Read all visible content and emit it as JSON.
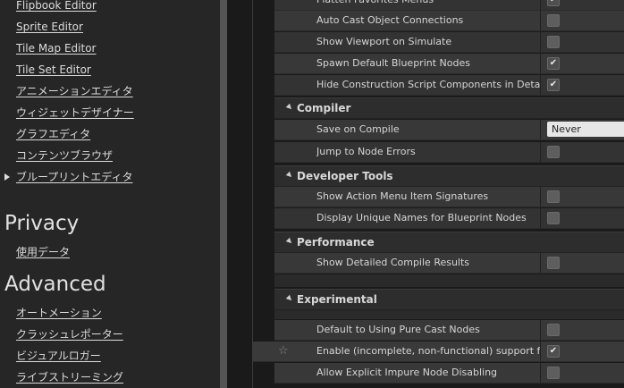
{
  "nav": {
    "editor_links": [
      "Flipbook Editor",
      "Sprite Editor",
      "Tile Map Editor",
      "Tile Set Editor",
      "アニメーションエディタ",
      "ウィジェットデザイナー",
      "グラフエディタ",
      "コンテンツブラウザ",
      "ブループリントエディタ"
    ],
    "privacy_title": "Privacy",
    "privacy_links": [
      "使用データ"
    ],
    "advanced_title": "Advanced",
    "advanced_links": [
      "オートメーション",
      "クラッシュレポーター",
      "ビジュアルロガー",
      "ライブストリーミング"
    ]
  },
  "settings": {
    "top_rows": [
      {
        "label": "Flatten Favorites Menus",
        "checked": true
      },
      {
        "label": "Auto Cast Object Connections",
        "checked": false
      },
      {
        "label": "Show Viewport on Simulate",
        "checked": false
      },
      {
        "label": "Spawn Default Blueprint Nodes",
        "checked": true
      },
      {
        "label": "Hide Construction Script Components in Details View",
        "checked": true
      }
    ],
    "compiler": {
      "title": "Compiler",
      "save_on_compile_label": "Save on Compile",
      "save_on_compile_value": "Never",
      "jump_label": "Jump to Node Errors",
      "jump_checked": false
    },
    "developer_tools": {
      "title": "Developer Tools",
      "rows": [
        {
          "label": "Show Action Menu Item Signatures",
          "checked": false
        },
        {
          "label": "Display Unique Names for Blueprint Nodes",
          "checked": false
        }
      ]
    },
    "performance": {
      "title": "Performance",
      "rows": [
        {
          "label": "Show Detailed Compile Results",
          "checked": false
        }
      ]
    },
    "experimental": {
      "title": "Experimental",
      "rows": [
        {
          "label": "Default to Using Pure Cast Nodes",
          "checked": false
        },
        {
          "label": "Enable (incomplete, non-functional) support for TSet",
          "checked": true
        },
        {
          "label": "Allow Explicit Impure Node Disabling",
          "checked": false
        }
      ]
    }
  }
}
